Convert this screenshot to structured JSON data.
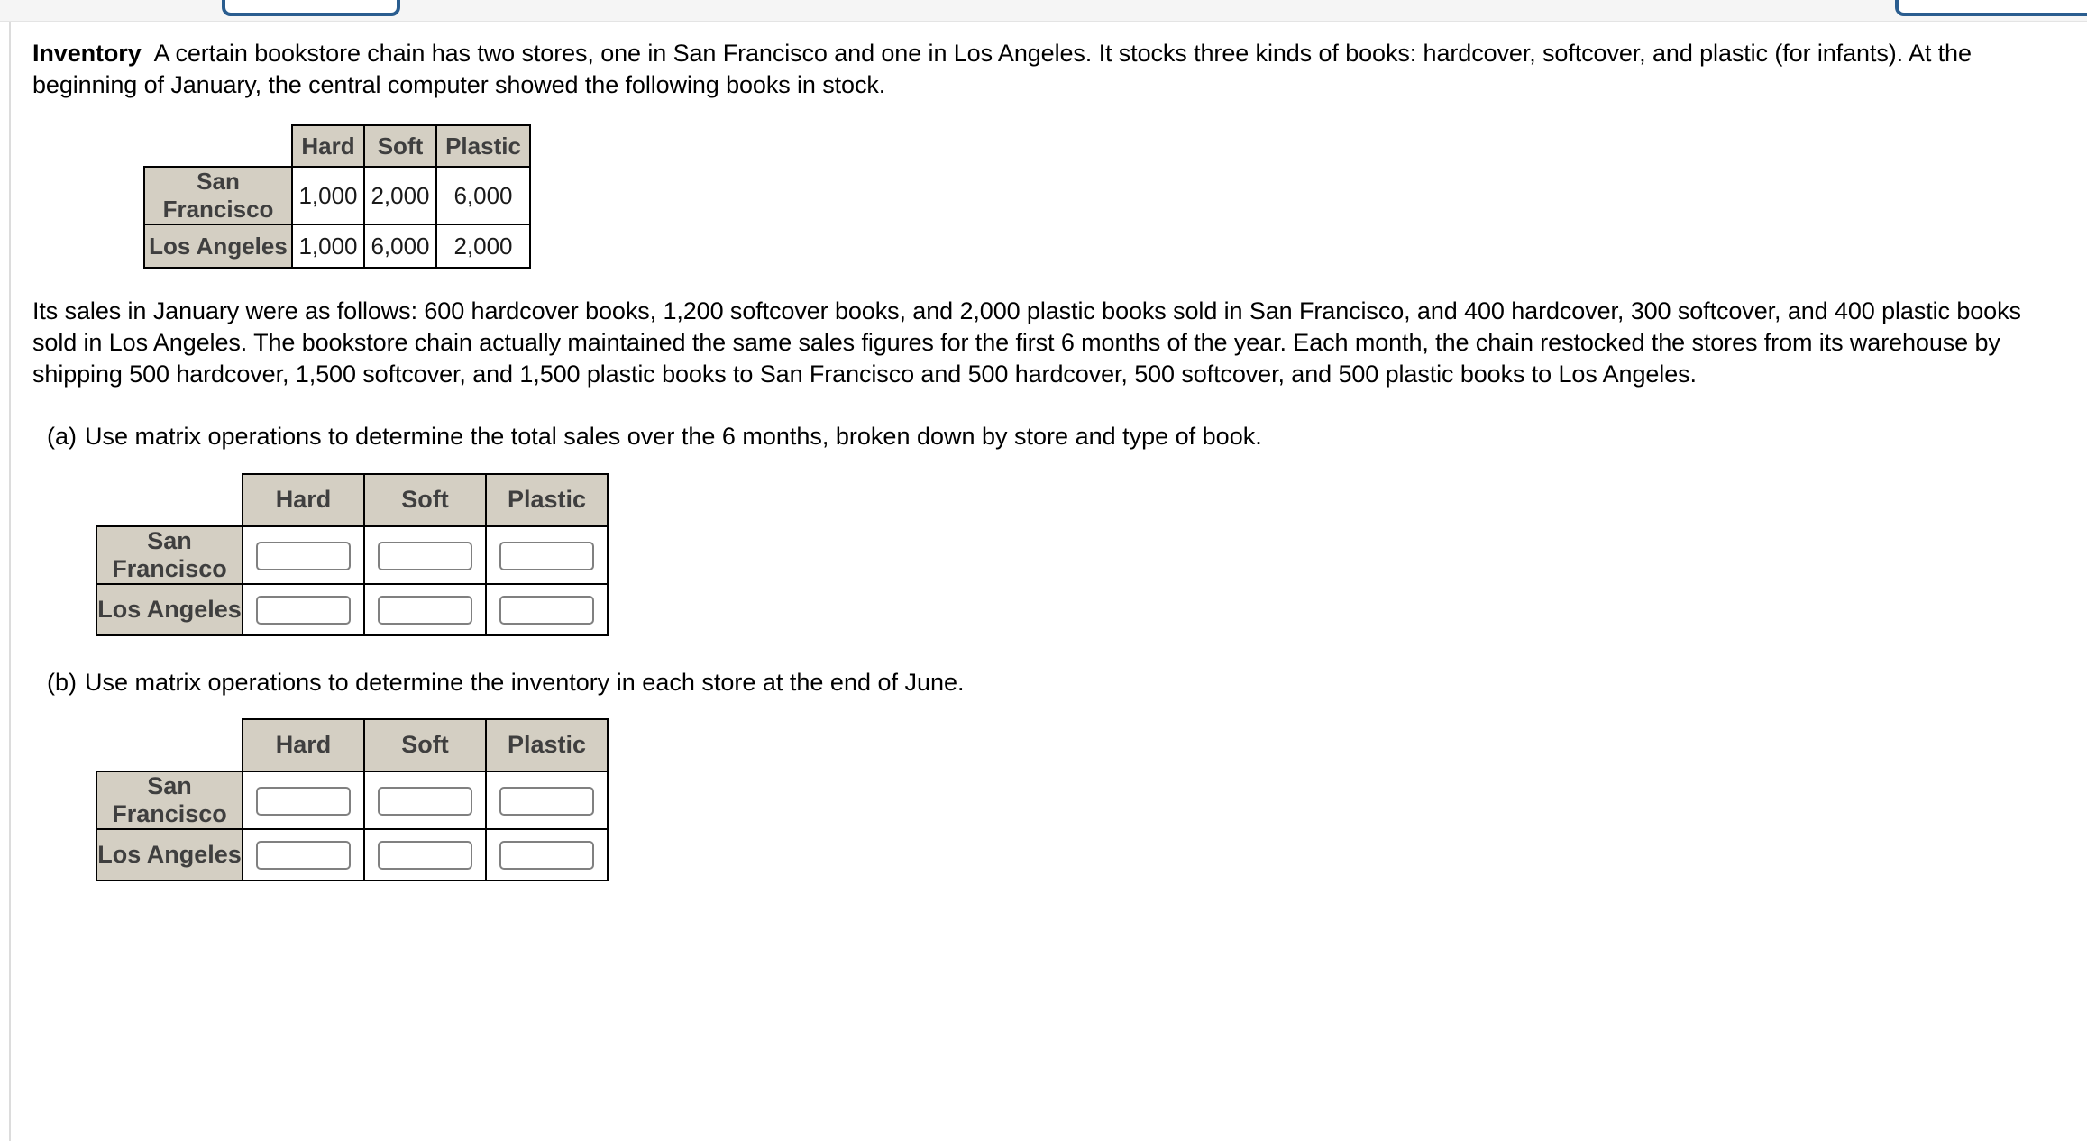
{
  "top_bar": {
    "left_button_label": "",
    "right_button_label": "",
    "accent_color": "#2a5d8f"
  },
  "problem": {
    "lead_label": "Inventory",
    "intro_text": "A certain bookstore chain has two stores, one in San Francisco and one in Los Angeles. It stocks three kinds of books: hardcover, softcover, and plastic (for infants). At the beginning of January, the central computer showed the following books in stock.",
    "sales_text": "Its sales in January were as follows: 600 hardcover books, 1,200 softcover books, and 2,000 plastic books sold in San Francisco, and 400 hardcover, 300 softcover, and 400 plastic books sold in Los Angeles. The bookstore chain actually maintained the same sales figures for the first 6 months of the year. Each month, the chain restocked the stores from its warehouse by shipping 500 hardcover, 1,500 softcover, and 1,500 plastic books to San Francisco and 500 hardcover, 500 softcover, and 500 plastic books to Los Angeles."
  },
  "stock_table": {
    "columns": [
      "Hard",
      "Soft",
      "Plastic"
    ],
    "rows": [
      {
        "label": "San Francisco",
        "values": [
          "1,000",
          "2,000",
          "6,000"
        ]
      },
      {
        "label": "Los Angeles",
        "values": [
          "1,000",
          "6,000",
          "2,000"
        ]
      }
    ],
    "header_bg": "#d4cfc3"
  },
  "part_a": {
    "label": "(a)",
    "text": "Use matrix operations to determine the total sales over the 6 months, broken down by store and type of book.",
    "table": {
      "columns": [
        "Hard",
        "Soft",
        "Plastic"
      ],
      "rows": [
        {
          "label": "San Francisco",
          "values": [
            "",
            "",
            ""
          ]
        },
        {
          "label": "Los Angeles",
          "values": [
            "",
            "",
            ""
          ]
        }
      ]
    }
  },
  "part_b": {
    "label": "(b)",
    "text": "Use matrix operations to determine the inventory in each store at the end of June.",
    "table": {
      "columns": [
        "Hard",
        "Soft",
        "Plastic"
      ],
      "rows": [
        {
          "label": "San Francisco",
          "values": [
            "",
            "",
            ""
          ]
        },
        {
          "label": "Los Angeles",
          "values": [
            "",
            "",
            ""
          ]
        }
      ]
    }
  }
}
